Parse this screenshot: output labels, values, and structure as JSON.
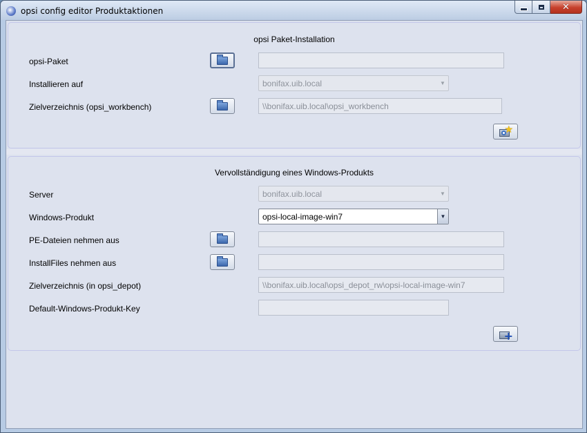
{
  "window": {
    "title": "opsi config editor Produktaktionen",
    "controls": {
      "close_glyph": "✕"
    }
  },
  "package_install": {
    "heading": "opsi Paket-Installation",
    "opsi_package": {
      "label": "opsi-Paket",
      "value": ""
    },
    "install_on": {
      "label": "Installieren auf",
      "value": "bonifax.uib.local"
    },
    "target_dir": {
      "label": "Zielverzeichnis (opsi_workbench)",
      "value": "\\\\bonifax.uib.local\\opsi_workbench"
    },
    "action_icon": "package-install-icon"
  },
  "windows_product": {
    "heading": "Vervollständigung eines Windows-Produkts",
    "server": {
      "label": "Server",
      "value": "bonifax.uib.local"
    },
    "product": {
      "label": "Windows-Produkt",
      "value": "opsi-local-image-win7"
    },
    "pe_files": {
      "label": "PE-Dateien nehmen aus",
      "value": ""
    },
    "install_files": {
      "label": "InstallFiles nehmen aus",
      "value": ""
    },
    "target_dir": {
      "label": "Zielverzeichnis (in opsi_depot)",
      "value": "\\\\bonifax.uib.local\\opsi_depot_rw\\opsi-local-image-win7"
    },
    "product_key": {
      "label": "Default-Windows-Produkt-Key",
      "value": ""
    },
    "action_icon": "package-add-icon"
  },
  "icons": {
    "folder": "folder-icon",
    "combo_arrow": "▼",
    "star": "★",
    "plus": "+"
  },
  "colors": {
    "client_bg": "#dde2ee",
    "panel_border": "#c3c6ea",
    "close_button": "#c7412d"
  }
}
